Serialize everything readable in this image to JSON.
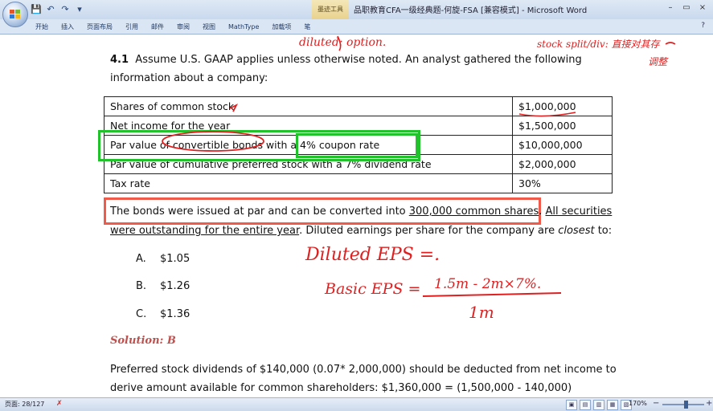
{
  "window": {
    "title": "品职教育CFA一级经典题-何旋-FSA [兼容模式] - Microsoft Word",
    "context_tab": "墨迹工具",
    "controls": [
      "–",
      "▭",
      "×"
    ]
  },
  "qat": [
    "💾",
    "↶",
    "↷",
    "▾"
  ],
  "ribbon": {
    "tabs": [
      "开始",
      "插入",
      "页面布局",
      "引用",
      "邮件",
      "审阅",
      "视图",
      "MathType",
      "加载项",
      "笔"
    ],
    "help": "?"
  },
  "document": {
    "question": {
      "number": "4.1",
      "stem_line1": "Assume U.S. GAAP applies unless otherwise noted. An analyst gathered the following",
      "stem_line2": "information about a company:"
    },
    "table": [
      {
        "label": "Shares of common stock",
        "value": "$1,000,000"
      },
      {
        "label": "Net income for the year",
        "value": "$1,500,000"
      },
      {
        "label": "Par value of convertible bonds with a 4% coupon rate",
        "value": "$10,000,000"
      },
      {
        "label": "Par value of cumulative preferred stock with a 7% dividend rate",
        "value": "$2,000,000"
      },
      {
        "label": "Tax rate",
        "value": "30%"
      }
    ],
    "para": {
      "p1": "The bonds were issued at par and can be converted into ",
      "p1_u": "300,000 common shares",
      "p1_end": ". ",
      "p1_tail": "All securities",
      "p2_u": "were outstanding for the entire year",
      "p2_a": ". Diluted earnings per share for the company are ",
      "p2_em": "closest",
      "p2_b": " to:"
    },
    "options": [
      {
        "letter": "A.",
        "text": "$1.05"
      },
      {
        "letter": "B.",
        "text": "$1.26"
      },
      {
        "letter": "C.",
        "text": "$1.36"
      }
    ],
    "solution_label": "Solution: B",
    "solution_line1": "Preferred stock dividends of $140,000 (0.07* 2,000,000) should be deducted from net income to",
    "solution_line2": "derive amount available for common shareholders: $1,360,000 = (1,500,000 - 140,000)"
  },
  "ink": {
    "top_left": "diluted: option.",
    "top_right": "stock split/div: 直接对其存",
    "top_right2": "调整",
    "diluted_eps": "Diluted EPS =.",
    "basic_eps": "Basic EPS =",
    "numerator": "1.5m - 2m×7%.",
    "denominator": "1m"
  },
  "status": {
    "page": "页面: 28/127",
    "zoom": "170%",
    "views": [
      "▣",
      "▤",
      "▥",
      "▦",
      "▧"
    ]
  }
}
